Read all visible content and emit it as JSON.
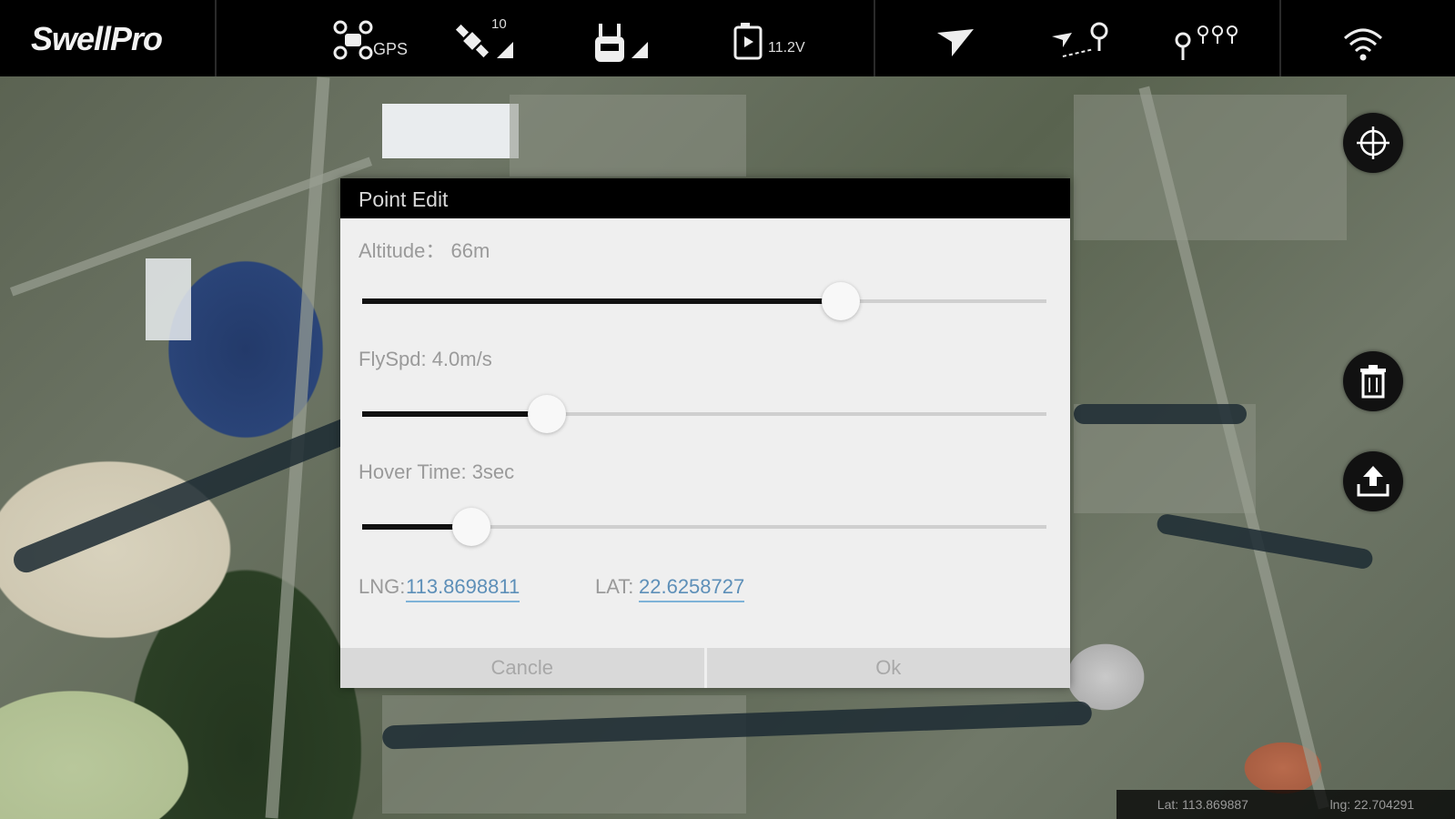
{
  "topbar": {
    "logo": "SwellPro",
    "gps_label": "GPS",
    "satellite_count": "10",
    "battery_voltage": "11.2V"
  },
  "dialog": {
    "title": "Point Edit",
    "altitude": {
      "label": "Altitude：  66m",
      "value_m": 66,
      "fraction": 0.7
    },
    "flyspeed": {
      "label": "FlySpd: 4.0m/s",
      "value_ms": 4.0,
      "fraction": 0.27
    },
    "hover": {
      "label": "Hover Time: 3sec",
      "value_s": 3,
      "fraction": 0.16
    },
    "lng_label": "LNG:",
    "lng_value": "113.8698811",
    "lat_label": "LAT: ",
    "lat_value": "22.6258727",
    "cancel_label": "Cancle",
    "ok_label": "Ok"
  },
  "readout": {
    "lat": "Lat:  113.869887",
    "lng": "lng:  22.704291"
  },
  "icons": {
    "drone": "drone-gps-icon",
    "satellite": "satellite-icon",
    "remote": "remote-controller-icon",
    "battery": "battery-icon",
    "send": "send-icon",
    "route": "route-point-icon",
    "waypoints": "waypoints-icon",
    "wifi": "wifi-icon",
    "locate": "crosshair-icon",
    "delete": "trash-icon",
    "upload": "upload-icon"
  }
}
